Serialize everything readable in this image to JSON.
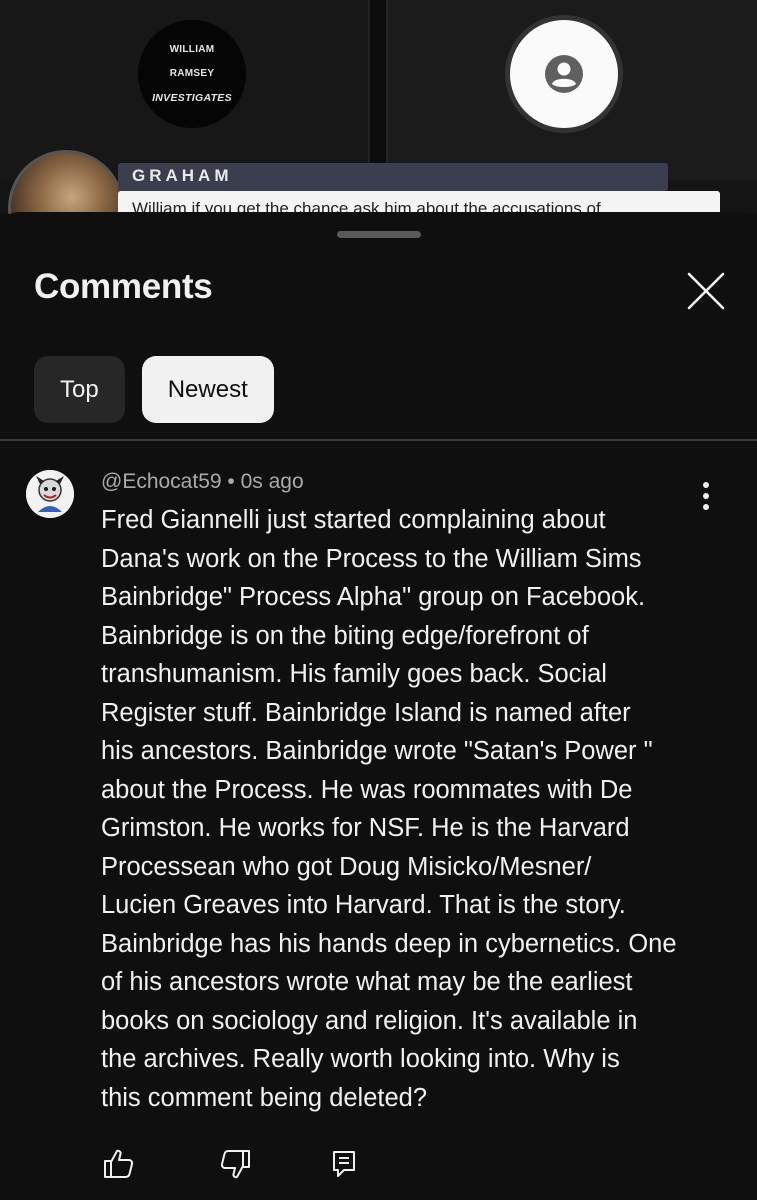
{
  "video": {
    "logo_lines": [
      "WILLIAM",
      "RAMSEY",
      "INVESTIGATES"
    ],
    "overlay_name": "GRAHAM",
    "overlay_message": "William if you get the chance ask him about the accusations of"
  },
  "comments_sheet": {
    "title": "Comments",
    "close_icon": "close-icon",
    "sort_chips": [
      {
        "label": "Top",
        "selected": false
      },
      {
        "label": "Newest",
        "selected": true
      }
    ]
  },
  "comment": {
    "author": "@Echocat59",
    "separator": "•",
    "time": "0s ago",
    "meta": "@Echocat59 • 0s ago",
    "text": "Fred Giannelli just started complaining about\nDana's work on the Process to the William Sims\nBainbridge\" Process Alpha\" group on Facebook.\nBainbridge is on the biting edge/forefront of\ntranshumanism. His family goes back. Social\nRegister stuff. Bainbridge Island is named after\nhis ancestors. Bainbridge wrote \"Satan's Power \"\nabout the Process. He was roommates with De\nGrimston.  He works for NSF. He is the Harvard\nProcessean who got Doug Misicko/Mesner/\nLucien Greaves into Harvard. That is the story.\nBainbridge has his hands deep in cybernetics. One\nof his ancestors wrote what may be the earliest\nbooks on sociology and religion. It's available in\nthe archives. Really worth looking into. Why is\nthis comment being deleted?",
    "actions": [
      "thumbs-up-icon",
      "thumbs-down-icon",
      "reply-icon"
    ]
  },
  "colors": {
    "background": "#0f0f0f",
    "chip_inactive": "#272727",
    "chip_active": "#f1f1f1",
    "meta_text": "#aaaaaa"
  }
}
